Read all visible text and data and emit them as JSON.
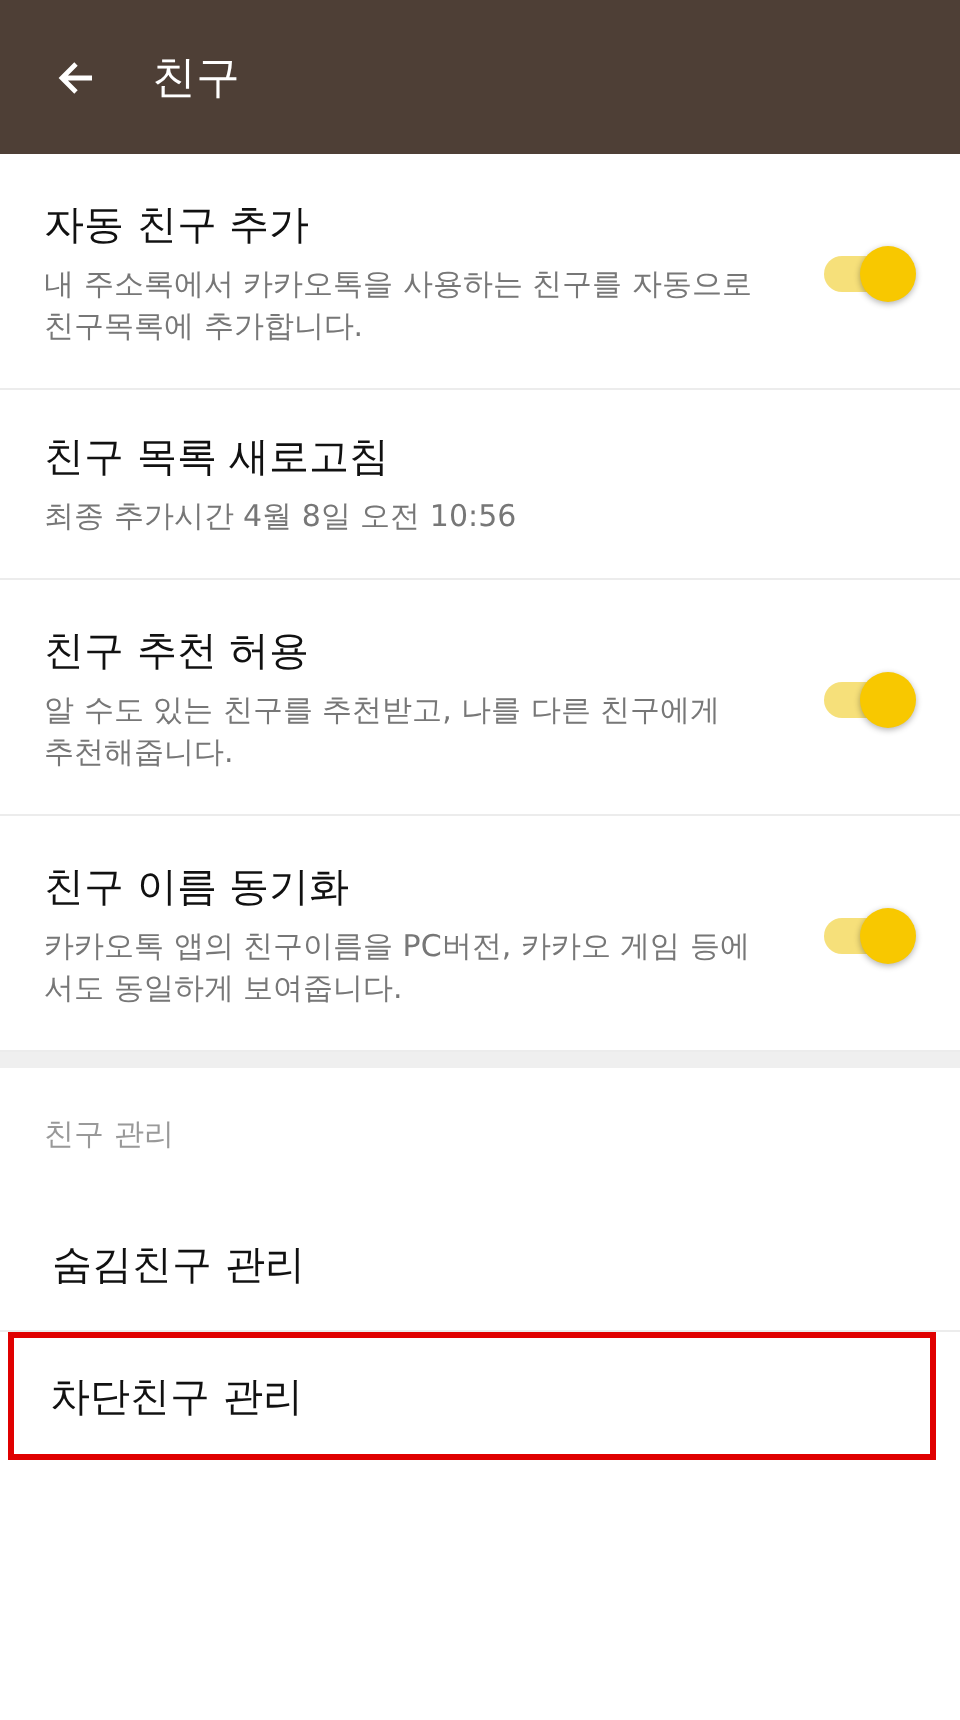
{
  "app_bar": {
    "title": "친구"
  },
  "settings": [
    {
      "kind": "toggle",
      "title": "자동 친구 추가",
      "description": "내 주소록에서 카카오톡을 사용하는 친구를 자동으로 친구목록에 추가합니다.",
      "on": true
    },
    {
      "kind": "info",
      "title": "친구 목록 새로고침",
      "description": "최종 추가시간 4월 8일 오전 10:56"
    },
    {
      "kind": "toggle",
      "title": "친구 추천 허용",
      "description": "알 수도 있는 친구를 추천받고, 나를 다른 친구에게 추천해줍니다.",
      "on": true
    },
    {
      "kind": "toggle",
      "title": "친구 이름 동기화",
      "description": "카카오톡 앱의 친구이름을 PC버전, 카카오 게임 등에서도 동일하게 보여줍니다.",
      "on": true
    }
  ],
  "section": {
    "header": "친구 관리",
    "items": [
      {
        "label": "숨김친구 관리",
        "highlighted": false
      },
      {
        "label": "차단친구 관리",
        "highlighted": true
      }
    ]
  }
}
